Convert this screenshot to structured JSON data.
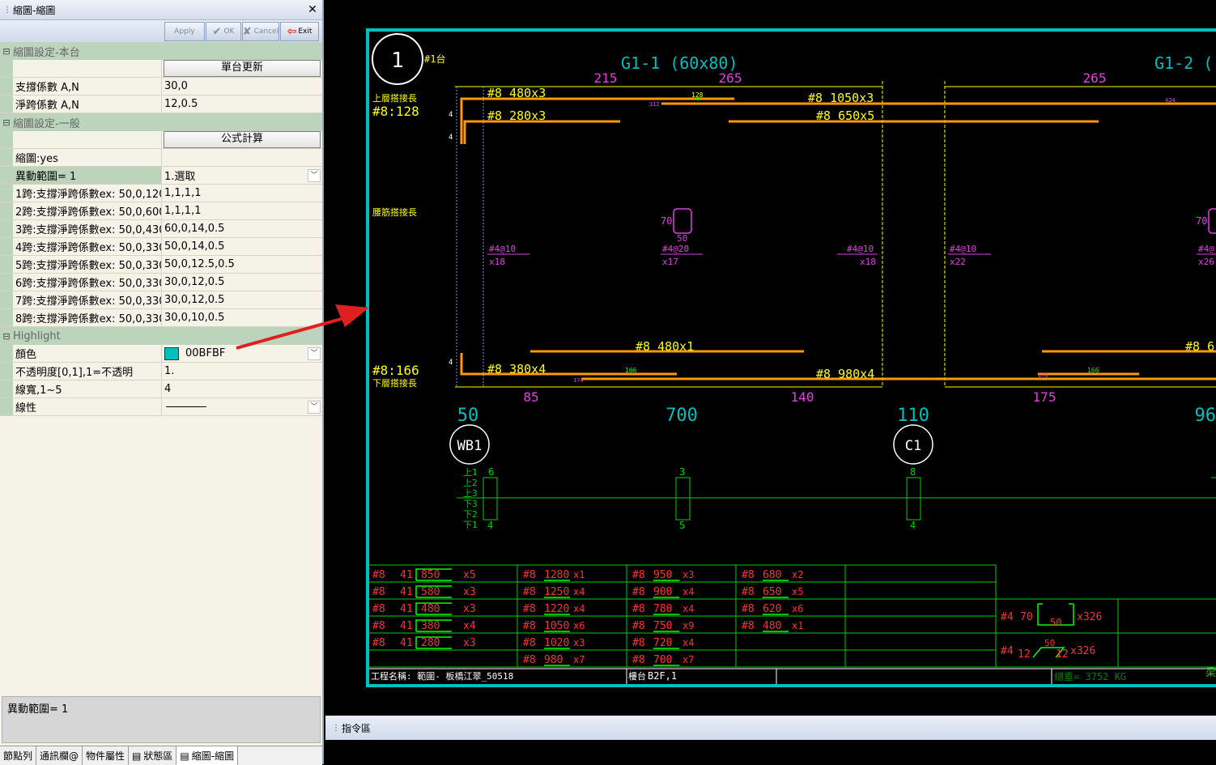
{
  "panel": {
    "title": "縮圖-縮圖",
    "close": "✕",
    "toolbar": {
      "apply": "Apply",
      "ok": "OK",
      "cancel": "Cancel",
      "exit": "Exit"
    },
    "section_local": "縮圖設定-本台",
    "btn_update": "單台更新",
    "support_label": "支撐係數 A,N",
    "support_value": "30,0",
    "netspan_label": "淨跨係數 A,N",
    "netspan_value": "12,0.5",
    "section_general": "縮圖設定-一般",
    "btn_formula": "公式計算",
    "thumb_label": "縮圖:yes",
    "range_label": "異動範圍= 1",
    "range_value": "1.選取",
    "spans": [
      {
        "label": "1跨:支撐淨跨係數ex: 50,0,120",
        "value": "1,1,1,1"
      },
      {
        "label": "2跨:支撐淨跨係數ex: 50,0,600",
        "value": "1,1,1,1"
      },
      {
        "label": "3跨:支撐淨跨係數ex: 50,0,430",
        "value": "60,0,14,0.5"
      },
      {
        "label": "4跨:支撐淨跨係數ex: 50,0,330",
        "value": "50,0,14,0.5"
      },
      {
        "label": "5跨:支撐淨跨係數ex: 50,0,330",
        "value": "50,0,12.5,0.5"
      },
      {
        "label": "6跨:支撐淨跨係數ex: 50,0,330",
        "value": "30,0,12,0.5"
      },
      {
        "label": "7跨:支撐淨跨係數ex: 50,0,330",
        "value": "30,0,12,0.5"
      },
      {
        "label": "8跨:支撐淨跨係數ex: 50,0,330",
        "value": "30,0,10,0.5"
      }
    ],
    "section_highlight": "Highlight",
    "color_label": "顏色",
    "color_value": "00BFBF",
    "color_hex": "#00BFBF",
    "opacity_label": "不透明度[0,1],1=不透明",
    "opacity_value": "1.",
    "width_label": "線寬,1~5",
    "width_value": "4",
    "style_label": "線性",
    "description": "異動範圍= 1",
    "tabs": [
      "節點列",
      "通訊欄@",
      "物件屬性",
      "狀態區",
      "縮圖-縮圖"
    ]
  },
  "command_bar": {
    "label": "指令區"
  },
  "cad": {
    "circle_number": "1",
    "circle_tag": "#1台",
    "beam1_title": "G1-1 (60x80)",
    "beam2_title": "G1-2 (",
    "dim_215": "215",
    "dim_265a": "265",
    "dim_265b": "265",
    "top_lap_label": "上層搭接長",
    "top_lap_value": "#8:128",
    "waist_lap_label": "腰筋搭接長",
    "bottom_lap_value": "#8:166",
    "bottom_lap_label": "下層搭接長",
    "bar_480x3": "#8  480x3",
    "bar_280x3": "#8  280x3",
    "bar_1050x3": "#8  1050x3",
    "bar_650x5": "#8  650x5",
    "bar_480x1": "#8  480x1",
    "bar_380x4": "#8  380x4",
    "bar_980x4": "#8  980x4",
    "bar_6": "#8  6",
    "small_128": "128",
    "small_312": "312",
    "small_424": "424",
    "small_166a": "166",
    "small_174": "174",
    "small_170": "170",
    "small_166b": "166",
    "side_4": "4",
    "stirrup_70a": "70",
    "stirrup_50a": "50",
    "stirrup_70b": "70",
    "st1_top": "#4@10",
    "st1_bot": "x18",
    "st2_top": "#4@20",
    "st2_bot": "x17",
    "st3_top": "#4@10",
    "st3_bot": "x18",
    "st4_top": "#4@10",
    "st4_bot": "x22",
    "st5_top": "#4@",
    "st5_bot": "x26",
    "bdim_85": "85",
    "bdim_140": "140",
    "bdim_175": "175",
    "col_50": "50",
    "col_700": "700",
    "col_110": "110",
    "col_96": "96",
    "node_wb1": "WB1",
    "node_c1": "C1",
    "lvl_labels": [
      "上1",
      "上2",
      "上3",
      "下3",
      "下2",
      "下1"
    ],
    "col_top": [
      "6",
      "3",
      "8"
    ],
    "col_bot": [
      "4",
      "5",
      "4"
    ],
    "schedule_col1": [
      {
        "bar": "#8",
        "hook": "41",
        "len": "850",
        "qty": "x5"
      },
      {
        "bar": "#8",
        "hook": "41",
        "len": "580",
        "qty": "x3"
      },
      {
        "bar": "#8",
        "hook": "41",
        "len": "480",
        "qty": "x3"
      },
      {
        "bar": "#8",
        "hook": "41",
        "len": "380",
        "qty": "x4"
      },
      {
        "bar": "#8",
        "hook": "41",
        "len": "280",
        "qty": "x3"
      }
    ],
    "schedule_col2": [
      {
        "bar": "#8",
        "len": "1280",
        "qty": "x1"
      },
      {
        "bar": "#8",
        "len": "1250",
        "qty": "x4"
      },
      {
        "bar": "#8",
        "len": "1220",
        "qty": "x4"
      },
      {
        "bar": "#8",
        "len": "1050",
        "qty": "x6"
      },
      {
        "bar": "#8",
        "len": "1020",
        "qty": "x3"
      },
      {
        "bar": "#8",
        "len": "980",
        "qty": "x7"
      }
    ],
    "schedule_col3": [
      {
        "bar": "#8",
        "len": "950",
        "qty": "x3"
      },
      {
        "bar": "#8",
        "len": "900",
        "qty": "x4"
      },
      {
        "bar": "#8",
        "len": "780",
        "qty": "x4"
      },
      {
        "bar": "#8",
        "len": "750",
        "qty": "x9"
      },
      {
        "bar": "#8",
        "len": "720",
        "qty": "x4"
      },
      {
        "bar": "#8",
        "len": "700",
        "qty": "x7"
      }
    ],
    "schedule_col4": [
      {
        "bar": "#8",
        "len": "680",
        "qty": "x2"
      },
      {
        "bar": "#8",
        "len": "650",
        "qty": "x5"
      },
      {
        "bar": "#8",
        "len": "620",
        "qty": "x6"
      },
      {
        "bar": "#8",
        "len": "480",
        "qty": "x1"
      }
    ],
    "stirrup_row1": {
      "bar": "#4",
      "a": "70",
      "b": "50",
      "qty": "x326"
    },
    "stirrup_row2": {
      "bar": "#4",
      "a": "12",
      "b": "50",
      "c": "12",
      "qty": "x326"
    },
    "footer_project": "工程名稱:  範圍- 板橋江翠_50518",
    "footer_floor": "B2F,1",
    "footer_floor_label": "樓台",
    "footer_weight": "總重= 3752 KG",
    "footer_right": "梁"
  }
}
